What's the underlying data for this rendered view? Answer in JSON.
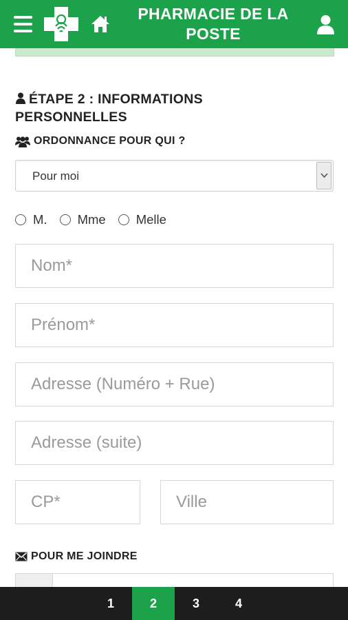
{
  "header": {
    "title": "PHARMACIE DE LA POSTE",
    "title_line1": "PHARMACIE DE LA",
    "title_line2": "POSTE",
    "menu_icon": "hamburger-menu-icon",
    "logo_icon": "pharmacy-cross-logo-icon",
    "home_icon": "home-icon",
    "user_icon": "user-icon",
    "brand_color": "#1ba24a"
  },
  "step": {
    "title": "ÉTAPE 2 : INFORMATIONS PERSONNELLES",
    "icon": "user-icon"
  },
  "prescription": {
    "label": "ORDONNANCE POUR QUI ?",
    "icon": "users-icon",
    "selected": "Pour moi"
  },
  "civility": {
    "options": [
      "M.",
      "Mme",
      "Melle"
    ]
  },
  "form": {
    "nom_placeholder": "Nom*",
    "prenom_placeholder": "Prénom*",
    "adresse_placeholder": "Adresse (Numéro + Rue)",
    "adresse_suite_placeholder": "Adresse (suite)",
    "cp_placeholder": "CP*",
    "ville_placeholder": "Ville"
  },
  "contact": {
    "label": "POUR ME JOINDRE",
    "icon": "envelope-icon"
  },
  "stepper": {
    "steps": [
      "1",
      "2",
      "3",
      "4"
    ],
    "active": "2"
  }
}
